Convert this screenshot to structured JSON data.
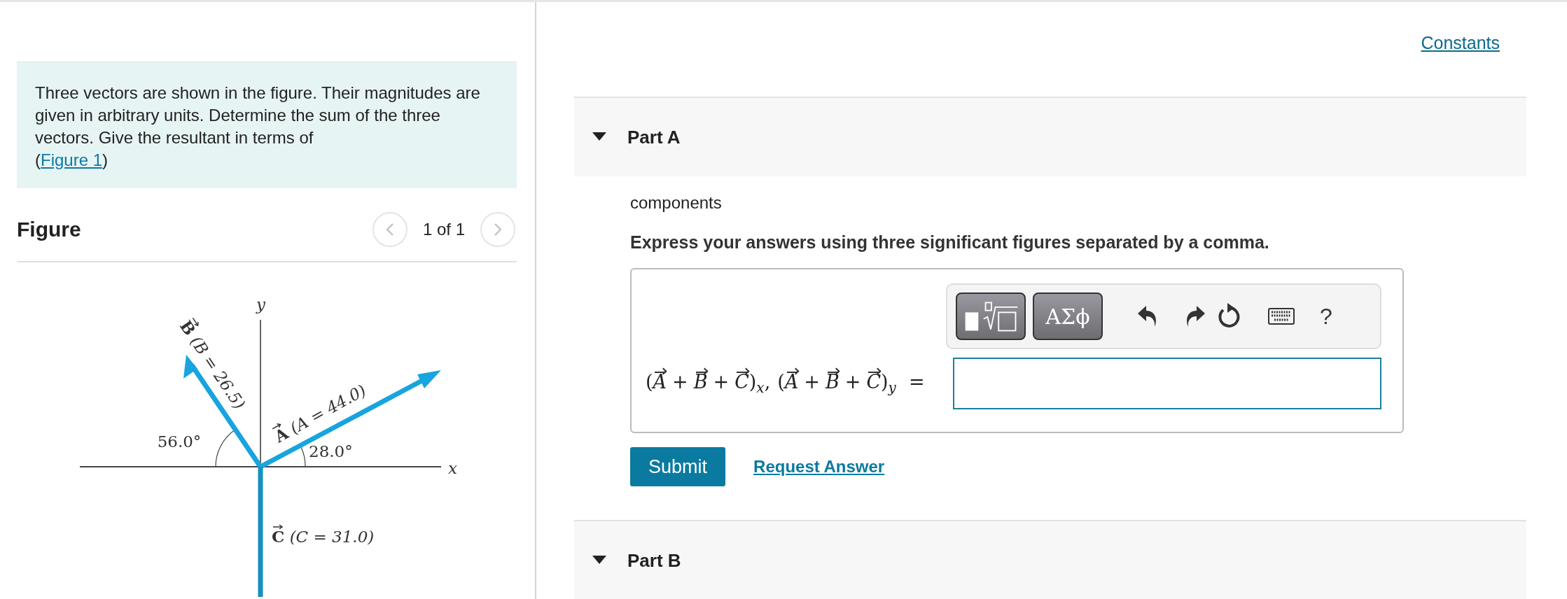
{
  "problem": {
    "text": "Three vectors are shown in the figure. Their magnitudes are given in arbitrary units. Determine the sum of the three vectors. Give the resultant in terms of",
    "link_prefix": "(",
    "link": "Figure 1",
    "link_suffix": ")"
  },
  "figure": {
    "title": "Figure",
    "pager": "1 of 1",
    "axes": {
      "x": "x",
      "y": "y"
    },
    "vectors": [
      {
        "name": "A",
        "label": "(A = 44.0)",
        "angle": "28.0°"
      },
      {
        "name": "B",
        "label": "(B = 26.5)",
        "angle": "56.0°"
      },
      {
        "name": "C",
        "label": "(C = 31.0)"
      }
    ]
  },
  "constants_link": "Constants",
  "parts": [
    {
      "title": "Part A",
      "body": {
        "intro": "components",
        "instruction": "Express your answers using three significant figures separated by a comma.",
        "toolbar": {
          "symbols": "ΑΣϕ",
          "help": "?"
        },
        "equation": {
          "terms": [
            {
              "open": "(",
              "vectors": [
                "A",
                "B",
                "C"
              ],
              "close": ")",
              "sub": "x",
              "sep": ","
            },
            {
              "open": "(",
              "vectors": [
                "A",
                "B",
                "C"
              ],
              "close": ")",
              "sub": "y"
            }
          ],
          "plus": "+",
          "equals": "="
        },
        "submit": "Submit",
        "request": "Request Answer"
      }
    },
    {
      "title": "Part B"
    }
  ]
}
